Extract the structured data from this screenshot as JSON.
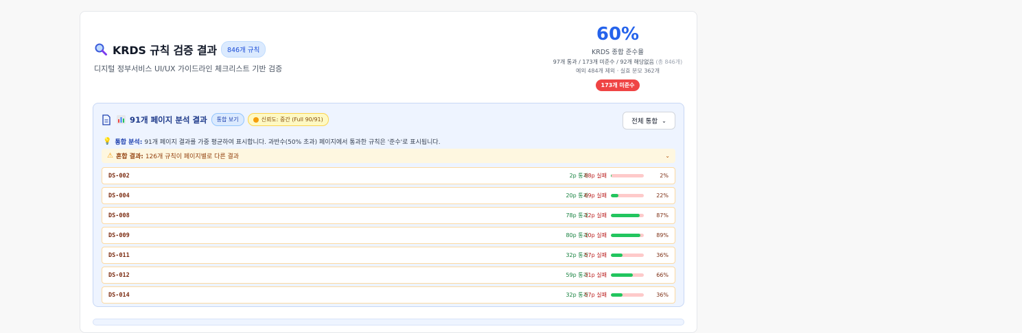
{
  "header": {
    "title": "KRDS 규칙 검증 결과",
    "rule_badge": "846개 규칙",
    "subtitle": "디지털 정부서비스 UI/UX 가이드라인 체크리스트 기반 검증"
  },
  "score": {
    "value": "60%",
    "label": "KRDS 종합 준수율",
    "detail": "97개 통과 / 173개 미준수 / 92개 해당없음",
    "detail_total": "(총 846개)",
    "detail2": "예외 484개 제외 · 실효 분모 362개",
    "fail_badge": "173개 미준수"
  },
  "panel": {
    "title": "91개 페이지 분석 결과",
    "view_badge": "통합 보기",
    "confidence": "신뢰도: 중간 (Full 90/91)",
    "select_label": "전체 통합",
    "info_strong": "통합 분석:",
    "info_text": "91개 페이지 결과를 가중 평균하여 표시합니다. 과반수(50% 초과) 페이지에서 통과한 규칙은 '준수'로 표시됩니다.",
    "mixed_strong": "혼합 결과:",
    "mixed_text": "126개 규칙이 페이지별로 다른 결과"
  },
  "rules": [
    {
      "id": "DS-002",
      "pass": "2p 통과",
      "fail": "88p 실패",
      "ratio": 0.02,
      "pct": "2%"
    },
    {
      "id": "DS-004",
      "pass": "20p 통과",
      "fail": "69p 실패",
      "ratio": 0.22,
      "pct": "22%"
    },
    {
      "id": "DS-008",
      "pass": "78p 통과",
      "fail": "12p 실패",
      "ratio": 0.87,
      "pct": "87%"
    },
    {
      "id": "DS-009",
      "pass": "80p 통과",
      "fail": "10p 실패",
      "ratio": 0.89,
      "pct": "89%"
    },
    {
      "id": "DS-011",
      "pass": "32p 통과",
      "fail": "57p 실패",
      "ratio": 0.36,
      "pct": "36%"
    },
    {
      "id": "DS-012",
      "pass": "59p 통과",
      "fail": "31p 실패",
      "ratio": 0.66,
      "pct": "66%"
    },
    {
      "id": "DS-014",
      "pass": "32p 통과",
      "fail": "57p 실패",
      "ratio": 0.36,
      "pct": "36%"
    }
  ],
  "colors": {
    "accent": "#2563eb",
    "fail": "#ef4444",
    "pass_bar": "#22c55e",
    "fail_bar": "#fecaca"
  },
  "icons": {
    "title": "magnifier-icon",
    "panel_doc": "document-icon",
    "panel_chart": "bar-chart-icon",
    "info": "lightbulb-icon",
    "mixed": "warning-icon",
    "select": "chevron-down-icon"
  }
}
